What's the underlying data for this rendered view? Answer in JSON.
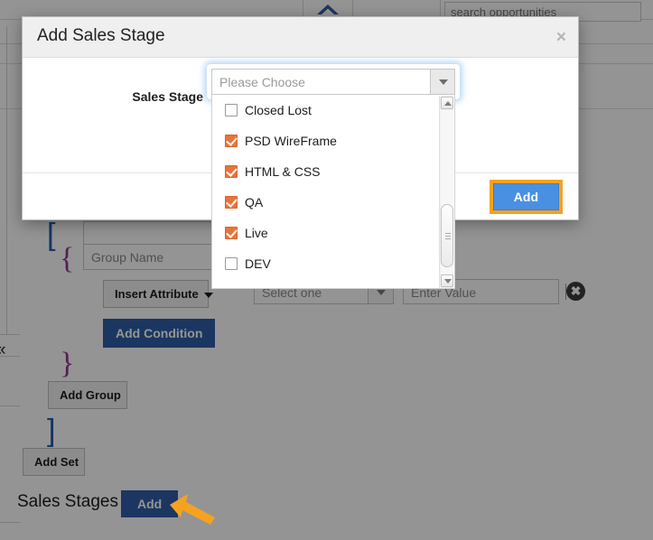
{
  "topbar": {
    "home_icon": "home-icon",
    "search_placeholder": "search opportunities"
  },
  "builder": {
    "group_name_placeholder": "Group Name",
    "insert_attribute_label": "Insert Attribute",
    "select_one_placeholder": "Select one",
    "enter_value_placeholder": "Enter Value",
    "add_condition_label": "Add Condition",
    "add_group_label": "Add Group",
    "add_set_label": "Add Set",
    "delete_icon": "delete-circle-x-icon",
    "open_brace": "{",
    "close_brace": "}",
    "open_bracket": "[",
    "close_bracket": "]",
    "rail_chevron": "«"
  },
  "sales_stages": {
    "label": "Sales Stages",
    "add_label": "Add",
    "annotation_icon": "orange-arrow-annotation",
    "annotation_color": "#f5a21f"
  },
  "modal": {
    "title": "Add Sales Stage",
    "close_label": "×",
    "close_icon": "close-icon",
    "field_label": "Sales Stage",
    "add_label": "Add",
    "add_button_color": "#4a90e2",
    "highlight_color": "#f5a21f"
  },
  "dropdown": {
    "placeholder": "Please Choose",
    "chevron_icon": "chevron-down-icon",
    "checkbox_checked_color": "#e8743b",
    "scrollbar": {
      "up_icon": "scroll-up-arrow-icon",
      "down_icon": "scroll-down-arrow-icon"
    },
    "options": [
      {
        "label": "Closed Lost",
        "checked": false
      },
      {
        "label": "PSD WireFrame",
        "checked": true
      },
      {
        "label": "HTML & CSS",
        "checked": true
      },
      {
        "label": "QA",
        "checked": true
      },
      {
        "label": "Live",
        "checked": true
      },
      {
        "label": "DEV",
        "checked": false
      }
    ]
  }
}
